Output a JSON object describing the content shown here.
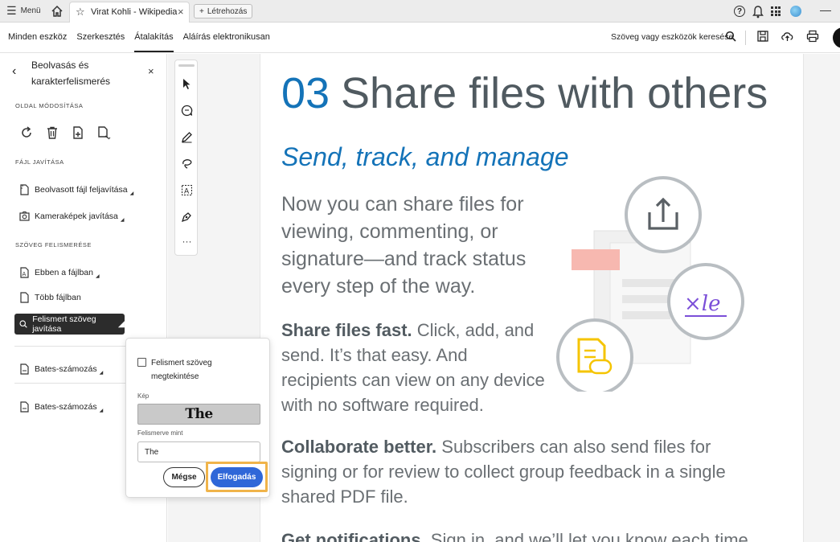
{
  "topbar": {
    "menu_label": "Menü",
    "tab_title": "Virat Kohli - Wikipedia",
    "new_tab_label": "Létrehozás"
  },
  "toolbar": {
    "nav": [
      "Minden eszköz",
      "Szerkesztés",
      "Átalakítás",
      "Aláírás elektronikusan"
    ],
    "active_nav": "Átalakítás",
    "search_tools": "Szöveg vagy eszközök keresése"
  },
  "left_panel": {
    "title": "Beolvasás és karakterfelismerés",
    "section_page": "OLDAL MÓDOSÍTÁSA",
    "section_fix": "FÁJL JAVÍTÁSA",
    "fix_items": [
      "Beolvasott fájl feljavítása",
      "Kameraképek javítása"
    ],
    "section_ocr": "SZÖVEG FELISMERÉSE",
    "ocr_items": [
      "Ebben a fájlban",
      "Több fájlban"
    ],
    "active_item": "Felismert szöveg javítása",
    "bates_items": [
      "Bates-számozás",
      "Bates-számozás"
    ]
  },
  "document": {
    "heading_number": "03",
    "heading_text": "Share files with others",
    "subheading": "Send, track, and manage",
    "lead": "Now you can share files for viewing, commenting, or signature—and track status every step of the way.",
    "para1_bold": "Share files fast.",
    "para1_text": " Click, add, and send. It’s that easy. And recipients can view on any device with no software required.",
    "para2_bold": "Collaborate better.",
    "para2_text": " Subscribers can also send files for signing or for review to collect group feedback in a single shared PDF file.",
    "para3_bold": "Get notifications.",
    "para3_text": " Sign in, and we’ll let you know each time"
  },
  "popup": {
    "checkbox_label": "Felismert szöveg megtekintése",
    "image_label": "Kép",
    "image_text": "The",
    "recognized_label": "Felismerve mint",
    "recognized_value": "The",
    "cancel_label": "Mégse",
    "accept_label": "Elfogadás"
  },
  "colors": {
    "accent_blue": "#1473b8",
    "button_blue": "#2f67d8",
    "highlight_orange": "#f0b44a"
  }
}
